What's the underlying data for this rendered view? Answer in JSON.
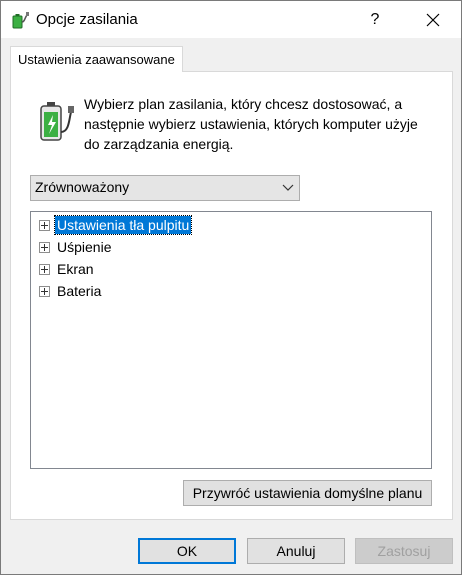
{
  "window": {
    "title": "Opcje zasilania",
    "help_label": "?",
    "close_label": "✕"
  },
  "tabs": [
    {
      "label": "Ustawienia zaawansowane",
      "active": true
    }
  ],
  "description": "Wybierz plan zasilania, który chcesz dostosować, a następnie wybierz ustawienia, których komputer użyje do zarządzania energią.",
  "plan_select": {
    "value": "Zrównoważony"
  },
  "tree": {
    "items": [
      {
        "label": "Ustawienia tła pulpitu",
        "selected": true,
        "expander": "+"
      },
      {
        "label": "Uśpienie",
        "selected": false,
        "expander": "+"
      },
      {
        "label": "Ekran",
        "selected": false,
        "expander": "+"
      },
      {
        "label": "Bateria",
        "selected": false,
        "expander": "+"
      }
    ]
  },
  "buttons": {
    "restore": "Przywróć ustawienia domyślne planu",
    "ok": "OK",
    "cancel": "Anuluj",
    "apply": "Zastosuj"
  },
  "colors": {
    "selection": "#0078d7",
    "battery_green": "#3cb043"
  },
  "icons": {
    "title": "power-options-icon",
    "battery": "battery-plug-icon",
    "dropdown": "chevron-down-icon",
    "expander": "plus-box-icon"
  }
}
